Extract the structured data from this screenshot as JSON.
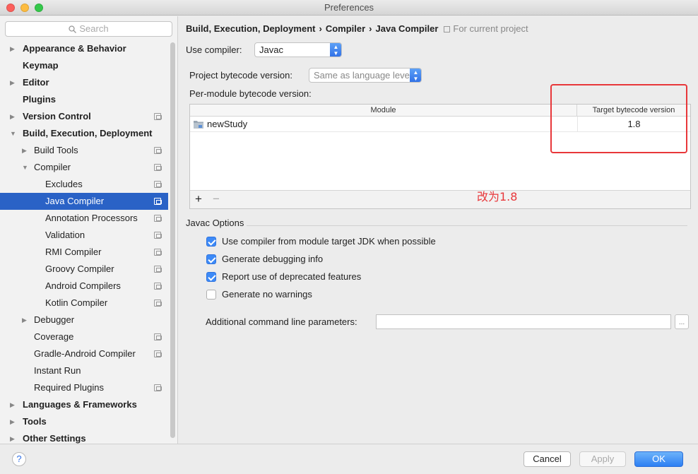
{
  "window": {
    "title": "Preferences"
  },
  "search": {
    "placeholder": "Search"
  },
  "sidebar": {
    "items": [
      {
        "label": "Appearance & Behavior",
        "level": 0,
        "arrow": "▶",
        "bold": true,
        "proj": false,
        "selected": false
      },
      {
        "label": "Keymap",
        "level": 0,
        "arrow": "",
        "bold": true,
        "proj": false,
        "selected": false
      },
      {
        "label": "Editor",
        "level": 0,
        "arrow": "▶",
        "bold": true,
        "proj": false,
        "selected": false
      },
      {
        "label": "Plugins",
        "level": 0,
        "arrow": "",
        "bold": true,
        "proj": false,
        "selected": false
      },
      {
        "label": "Version Control",
        "level": 0,
        "arrow": "▶",
        "bold": true,
        "proj": true,
        "selected": false
      },
      {
        "label": "Build, Execution, Deployment",
        "level": 0,
        "arrow": "▼",
        "bold": true,
        "proj": false,
        "selected": false
      },
      {
        "label": "Build Tools",
        "level": 1,
        "arrow": "▶",
        "bold": false,
        "proj": true,
        "selected": false
      },
      {
        "label": "Compiler",
        "level": 1,
        "arrow": "▼",
        "bold": false,
        "proj": true,
        "selected": false
      },
      {
        "label": "Excludes",
        "level": 2,
        "arrow": "",
        "bold": false,
        "proj": true,
        "selected": false
      },
      {
        "label": "Java Compiler",
        "level": 2,
        "arrow": "",
        "bold": false,
        "proj": true,
        "selected": true
      },
      {
        "label": "Annotation Processors",
        "level": 2,
        "arrow": "",
        "bold": false,
        "proj": true,
        "selected": false
      },
      {
        "label": "Validation",
        "level": 2,
        "arrow": "",
        "bold": false,
        "proj": true,
        "selected": false
      },
      {
        "label": "RMI Compiler",
        "level": 2,
        "arrow": "",
        "bold": false,
        "proj": true,
        "selected": false
      },
      {
        "label": "Groovy Compiler",
        "level": 2,
        "arrow": "",
        "bold": false,
        "proj": true,
        "selected": false
      },
      {
        "label": "Android Compilers",
        "level": 2,
        "arrow": "",
        "bold": false,
        "proj": true,
        "selected": false
      },
      {
        "label": "Kotlin Compiler",
        "level": 2,
        "arrow": "",
        "bold": false,
        "proj": true,
        "selected": false
      },
      {
        "label": "Debugger",
        "level": 1,
        "arrow": "▶",
        "bold": false,
        "proj": false,
        "selected": false
      },
      {
        "label": "Coverage",
        "level": 1,
        "arrow": "",
        "bold": false,
        "proj": true,
        "selected": false
      },
      {
        "label": "Gradle-Android Compiler",
        "level": 1,
        "arrow": "",
        "bold": false,
        "proj": true,
        "selected": false
      },
      {
        "label": "Instant Run",
        "level": 1,
        "arrow": "",
        "bold": false,
        "proj": false,
        "selected": false
      },
      {
        "label": "Required Plugins",
        "level": 1,
        "arrow": "",
        "bold": false,
        "proj": true,
        "selected": false
      },
      {
        "label": "Languages & Frameworks",
        "level": 0,
        "arrow": "▶",
        "bold": true,
        "proj": false,
        "selected": false
      },
      {
        "label": "Tools",
        "level": 0,
        "arrow": "▶",
        "bold": true,
        "proj": false,
        "selected": false
      },
      {
        "label": "Other Settings",
        "level": 0,
        "arrow": "▶",
        "bold": true,
        "proj": false,
        "selected": false
      }
    ]
  },
  "breadcrumb": {
    "part1": "Build, Execution, Deployment",
    "part2": "Compiler",
    "part3": "Java Compiler",
    "separator": "›",
    "scope": "For current project"
  },
  "form": {
    "use_compiler_label": "Use compiler:",
    "use_compiler_value": "Javac",
    "project_bytecode_label": "Project bytecode version:",
    "project_bytecode_value": "Same as language level",
    "per_module_label": "Per-module bytecode version:"
  },
  "module_table": {
    "col_module": "Module",
    "col_target": "Target bytecode version",
    "rows": [
      {
        "module": "newStudy",
        "target": "1.8"
      }
    ],
    "add": "+",
    "remove": "−"
  },
  "annotation": {
    "text": "改为1.8",
    "color": "#e8373a"
  },
  "javac": {
    "section_title": "Javac Options",
    "options": [
      {
        "label": "Use compiler from module target JDK when possible",
        "checked": true
      },
      {
        "label": "Generate debugging info",
        "checked": true
      },
      {
        "label": "Report use of deprecated features",
        "checked": true
      },
      {
        "label": "Generate no warnings",
        "checked": false
      }
    ],
    "params_label": "Additional command line parameters:",
    "params_value": "",
    "params_button": "..."
  },
  "footer": {
    "help": "?",
    "cancel": "Cancel",
    "apply": "Apply",
    "ok": "OK"
  },
  "colors": {
    "accent": "#2a62c6",
    "ok_button": "#2d7ff3",
    "annotation": "#e8373a"
  }
}
